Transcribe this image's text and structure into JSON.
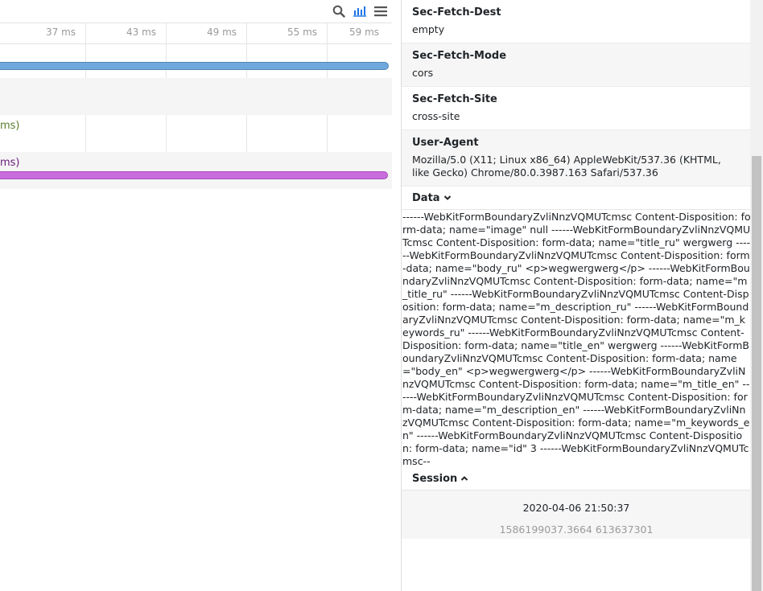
{
  "timeline": {
    "ticks": [
      "37 ms",
      "43 ms",
      "49 ms",
      "55 ms",
      "59 ms"
    ],
    "rows": [
      {
        "label": "",
        "bar_color": "#6fa8dc"
      },
      {
        "label": "",
        "bar_color": ""
      },
      {
        "label": "ms)",
        "label_color": "#5a7d2a"
      },
      {
        "label": "ms)",
        "label_color": "#6a1b7a",
        "bar_color": "#c96ddc"
      }
    ]
  },
  "headers": [
    {
      "name": "Sec-Fetch-Dest",
      "value": "empty"
    },
    {
      "name": "Sec-Fetch-Mode",
      "value": "cors"
    },
    {
      "name": "Sec-Fetch-Site",
      "value": "cross-site"
    },
    {
      "name": "User-Agent",
      "value": "Mozilla/5.0 (X11; Linux x86_64) AppleWebKit/537.36 (KHTML, like Gecko) Chrome/80.0.3987.163 Safari/537.36"
    }
  ],
  "data_section": {
    "title": "Data",
    "text": "------WebKitFormBoundaryZvliNnzVQMUTcmsc Content-Disposition: form-data; name=\"image\" null ------WebKitFormBoundaryZvliNnzVQMUTcmsc Content-Disposition: form-data; name=\"title_ru\" wergwerg ------WebKitFormBoundaryZvliNnzVQMUTcmsc Content-Disposition: form-data; name=\"body_ru\" <p>wegwergwerg</p> ------WebKitFormBoundaryZvliNnzVQMUTcmsc Content-Disposition: form-data; name=\"m_title_ru\" ------WebKitFormBoundaryZvliNnzVQMUTcmsc Content-Disposition: form-data; name=\"m_description_ru\" ------WebKitFormBoundaryZvliNnzVQMUTcmsc Content-Disposition: form-data; name=\"m_keywords_ru\" ------WebKitFormBoundaryZvliNnzVQMUTcmsc Content-Disposition: form-data; name=\"title_en\" wergwerg ------WebKitFormBoundaryZvliNnzVQMUTcmsc Content-Disposition: form-data; name=\"body_en\" <p>wegwergwerg</p> ------WebKitFormBoundaryZvliNnzVQMUTcmsc Content-Disposition: form-data; name=\"m_title_en\" ------WebKitFormBoundaryZvliNnzVQMUTcmsc Content-Disposition: form-data; name=\"m_description_en\" ------WebKitFormBoundaryZvliNnzVQMUTcmsc Content-Disposition: form-data; name=\"m_keywords_en\" ------WebKitFormBoundaryZvliNnzVQMUTcmsc Content-Disposition: form-data; name=\"id\" 3 ------WebKitFormBoundaryZvliNnzVQMUTcmsc--"
  },
  "session_section": {
    "title": "Session",
    "date": "2020-04-06 21:50:37",
    "timestamp": "1586199037.3664 613637301"
  },
  "icons": {
    "search": "search-icon",
    "chart": "bar-chart-icon",
    "menu": "hamburger-menu-icon",
    "chevron_down": "chevron-down-icon",
    "chevron_up": "chevron-up-icon"
  },
  "colors": {
    "accent": "#1a73e8",
    "bar_blue": "#6fa8dc",
    "bar_purple": "#c96ddc"
  }
}
